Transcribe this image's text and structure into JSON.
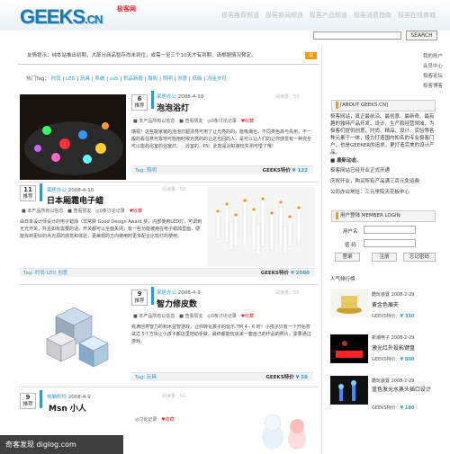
{
  "header": {
    "logo": "GEEKS",
    "logo_suffix": ".CN",
    "logo_tag": "极客网",
    "nav": [
      "极客推荐频道",
      "极客新闻频道",
      "极客产品频道",
      "极客消费指南",
      "极客在线商城"
    ],
    "search_button": "SEARCH"
  },
  "notice": "友情提示：纯本站推出初期，大部分商品暂存尚未到位，或需一至三个10天才有到期，请根据情况预定。",
  "tag_row": {
    "label": "热门Tag",
    "tags": [
      "时尚",
      "LED",
      "玩具",
      "系统",
      "usb",
      "积品新奇",
      "摄影",
      "照明",
      "创意",
      "低碳",
      "流金岁月"
    ]
  },
  "sidebar_links": [
    "我的账户",
    "会员中心",
    "极客论坛",
    "极客博客"
  ],
  "about": {
    "title": "[ABOUT GEEKS.CN]",
    "text": "极客网站，真正最前沿、最创意、最新奇、最有趣的独特产品开发、设计、生产和经营领域，为极客们提供创意、时尚、精品、设计、实验等各种元素于一体，极力打造国内知名的专业极客门户，也是GEEKER的追求，更打造完美的设计产品。"
  },
  "side_rows": [
    "最新动态",
    "极客网站已经开业正式开通",
    "庆祝开业，购买所有产品满三百元免运费",
    "公司办公地址：三元学院天花板中心"
  ],
  "login": {
    "title": "用户登陆 MEMBER LOGIN",
    "user_label": "用户名",
    "pass_label": "密  码",
    "login_btn": "登录",
    "register_btn": "注册",
    "forgot_btn": "忘记密码"
  },
  "popular": {
    "title": "人气排行榜",
    "items": [
      {
        "author": "酷玩装置",
        "date": "2008-2-29",
        "name": "黄金色展夫",
        "price_label": "GEEKS特价",
        "price": "¥ 330"
      },
      {
        "author": "新潮电子",
        "date": "2008-2-29",
        "name": "激光红外投影键盘",
        "price_label": "GEEKS特价",
        "price": "¥ 800"
      },
      {
        "author": "酷玩装置",
        "date": "2008-2-29",
        "name": "蓝色发光水蒸头插口设计",
        "price_label": "GEEKS特价",
        "price": "¥ 180"
      }
    ]
  },
  "cards": [
    {
      "votes": "6",
      "vote_label": "推荐",
      "category": "家居办公",
      "date": "2008-4-10",
      "reads": "阅读量：53",
      "title": "泡泡浴灯",
      "sub": "本产品所有以信息",
      "extra": "查看赞友",
      "comments": "0条讨论记录",
      "fav": "收藏",
      "desc": "瑞视！这些能家装的泡泡灯超漂亮可用了让光亮的的，能吸潮也，不同类色高与先用，不一般的看任意可靠地可能用时候光亮的的让这也回的人，是可以让人们的让你感觉有一种完全可以能的浴室的浴室灯。.. 浴室的.. PS：此款是浴缸装玩实测可惜了哦！",
      "tag": "照明",
      "price_label": "GEEKS特价",
      "price": "¥ 122"
    },
    {
      "votes": "11",
      "vote_label": "推荐",
      "category": "家居办公",
      "date": "2008-4-10",
      "reads": "阅读量：58",
      "title": "日本厢霜电子蜡",
      "sub": "本产品所有以信息",
      "extra": "查看赞友",
      "comments": "0条讨论记录",
      "fav": "收藏",
      "desc": "由日本设计师设计的电子蜡烛（非常获 Good Design Award 奖，内部使用LED灯，可调到无光开关，并且如有需要的话，开关都可以全面关闭，有一些功能被用在电子蜡烛里面，便能找到更好的点光源的感觉和体验，更美观的方向使用时更多配合比较灯的使用。",
      "tag": "时尚 LED 创意",
      "price_label": "GEEKS特价",
      "price": "¥ 2080"
    },
    {
      "votes": "9",
      "vote_label": "推荐",
      "category": "家居办公",
      "date": "2008-4-9",
      "reads": "阅读量：55",
      "title": "智力修皮数",
      "sub": "本产品所有以信息",
      "extra": "查看赞友",
      "comments": "0条讨论记录",
      "fav": "收藏",
      "desc": "充满创意智力的积木益智游戏，让你转化孩子的玩乐 TM 4-- 6 时！小孩子只有一个开始尝试过 5个方块让小孩子都这里地动手做，最终都能玩出来一套自己的作品的照片，需要通过游戏。",
      "tag": "玩具",
      "price_label": "GEEKS特价",
      "price": "¥ 58"
    },
    {
      "votes": "9",
      "vote_label": "推荐",
      "category": "电脑附件",
      "date": "2008-4-9",
      "reads": "阅读量：51",
      "title": "Msn 小人",
      "sub": "",
      "extra": "",
      "comments": "讨论记录",
      "fav": "收藏",
      "desc": "",
      "tag": "",
      "price_label": "",
      "price": ""
    }
  ],
  "watermark": "奇客发现 diglog.com"
}
